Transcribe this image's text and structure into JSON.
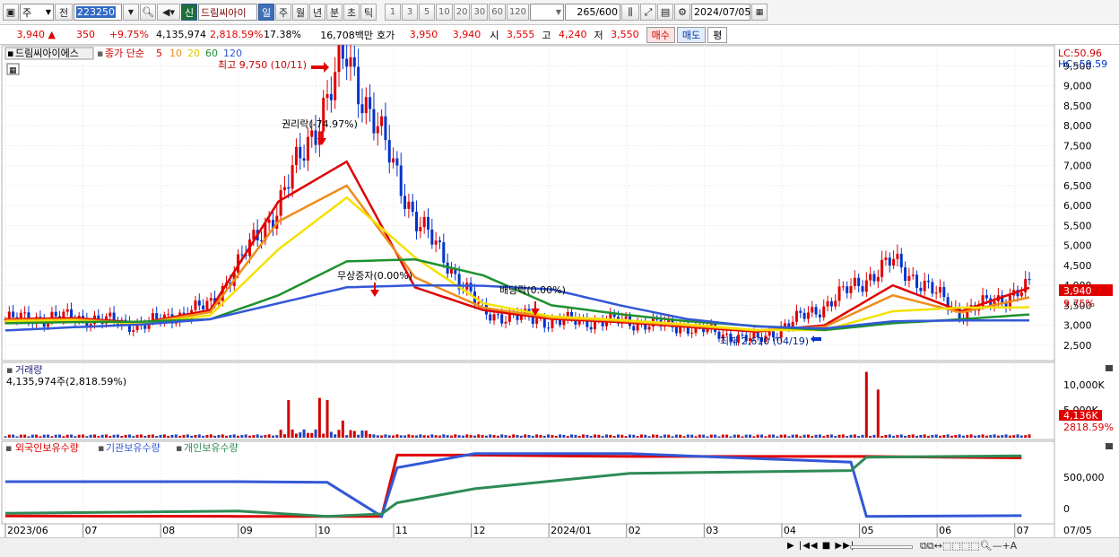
{
  "toolbar": {
    "market_type": "주",
    "prev_label": "전",
    "code": "223250",
    "stock_name_badge": "신",
    "stock_name": "드림씨아이",
    "periods": [
      "일",
      "주",
      "월",
      "년",
      "분",
      "초",
      "틱"
    ],
    "active_period": "일",
    "minute_units": [
      "1",
      "3",
      "5",
      "10",
      "20",
      "30",
      "60",
      "120"
    ],
    "count_value": "265",
    "count_total": "/600",
    "date": "2024/07/05"
  },
  "quote": {
    "price": "3,940",
    "arrow": "▲",
    "change": "350",
    "change_pct": "+9.75%",
    "volume": "4,135,974",
    "volume_ratio": "2,818.59%",
    "turnover": "17.38%",
    "trade_amount": "16,708백만",
    "hoga_label": "호가",
    "ask": "3,950",
    "bid": "3,940",
    "open_label": "시",
    "open": "3,555",
    "high_label": "고",
    "high": "4,240",
    "low_label": "저",
    "low": "3,550",
    "buy_label": "매수",
    "sell_label": "매도",
    "avg_label": "평"
  },
  "price_panel": {
    "stock_chip": "드림씨아이에스",
    "ma_title": "종가 단순",
    "ma_periods": [
      "5",
      "10",
      "20",
      "60",
      "120"
    ],
    "ma_colors": [
      "#e00000",
      "#f08c1a",
      "#f5e100",
      "#1e9130",
      "#3358d6"
    ],
    "lc": "LC:50.96",
    "hc": "HC:-59.59",
    "last_price_tag": "3,940",
    "last_pct_tag": "9.75%",
    "ann_high": "최고 9,750 (10/11)",
    "ann_rights": "권리락(-74.97%)",
    "ann_bonus": "무상증자(0.00%)",
    "ann_dividend": "배당락(0.00%)",
    "ann_low": "최저 2,610 (04/19)"
  },
  "volume_panel": {
    "title": "거래량",
    "summary": "4,135,974주(2,818.59%)",
    "ticks": [
      "10,000K",
      "5,000K"
    ],
    "last_tag": "4,136K",
    "last_pct": "2818.59%"
  },
  "holding_panel": {
    "legend": [
      "외국인보유수량",
      "기관보유수량",
      "개인보유수량"
    ],
    "legend_colors": [
      "#e00000",
      "#3358d6",
      "#2e8b57"
    ],
    "ticks": [
      "500,000",
      "0"
    ]
  },
  "x_axis": {
    "labels": [
      "2023/06",
      "07",
      "08",
      "09",
      "10",
      "11",
      "12",
      "2024/01",
      "02",
      "03",
      "04",
      "05",
      "06",
      "07"
    ],
    "right_label": "07/05"
  },
  "chart_data": [
    {
      "type": "candlestick",
      "title": "드림씨아이에스",
      "period": "daily",
      "x_range": [
        "2023/06/01",
        "2024/07/05"
      ],
      "y_ticks": [
        2500,
        3000,
        3500,
        4000,
        4500,
        5000,
        5500,
        6000,
        6500,
        7000,
        7500,
        8000,
        8500,
        9000,
        9500
      ],
      "ylim": [
        2250,
        9800
      ],
      "series": [
        {
          "name": "5",
          "values": [
            3150,
            3180,
            3060,
            3380,
            6100,
            7100,
            3950,
            3380,
            3160,
            3080,
            2960,
            2840,
            3000,
            4000,
            3350,
            3940
          ]
        },
        {
          "name": "10",
          "values": [
            3130,
            3150,
            3050,
            3330,
            5600,
            6500,
            4200,
            3440,
            3190,
            3110,
            2990,
            2870,
            2960,
            3750,
            3320,
            3700
          ]
        },
        {
          "name": "20",
          "values": [
            3100,
            3120,
            3040,
            3250,
            4900,
            6200,
            4700,
            3550,
            3220,
            3130,
            3020,
            2880,
            2880,
            3350,
            3440,
            3450
          ]
        },
        {
          "name": "60",
          "values": [
            3050,
            3080,
            3090,
            3150,
            3750,
            4600,
            4650,
            4250,
            3500,
            3280,
            3100,
            2980,
            2880,
            3050,
            3150,
            3270
          ]
        },
        {
          "name": "120",
          "values": [
            2870,
            2950,
            3020,
            3150,
            3550,
            3950,
            4000,
            3990,
            3900,
            3500,
            3150,
            2970,
            2920,
            3100,
            3120,
            3120
          ]
        }
      ],
      "close_key": {
        "dates": [
          "2023/06",
          "2023/07",
          "2023/08",
          "2023/09",
          "2023/09/20",
          "2023/10/11",
          "2023/10/20",
          "2023/11",
          "2023/12",
          "2024/01",
          "2024/02",
          "2024/04/19",
          "2024/05",
          "2024/05/10",
          "2024/06",
          "2024/07/05"
        ],
        "close": [
          3150,
          3200,
          3000,
          3500,
          6000,
          9750,
          5700,
          3300,
          3100,
          3100,
          2950,
          2610,
          3500,
          4600,
          3300,
          3940
        ]
      }
    },
    {
      "type": "bar",
      "title": "거래량",
      "unit": "K shares",
      "ylim": [
        0,
        12000
      ],
      "peaks": [
        {
          "date": "2023/09/20",
          "value": 6800
        },
        {
          "date": "2023/10/02",
          "value": 7200
        },
        {
          "date": "2023/10/05",
          "value": 6800
        },
        {
          "date": "2023/10/11",
          "value": 3100
        },
        {
          "date": "2024/05/02",
          "value": 11900
        },
        {
          "date": "2024/05/06",
          "value": 8700
        },
        {
          "date": "2024/07/05",
          "value": 4136
        }
      ]
    },
    {
      "type": "line",
      "title": "보유수량",
      "ylim": [
        -50000,
        1000000
      ],
      "x": [
        "2023/06",
        "2023/09",
        "2023/10/05",
        "2023/10/25",
        "2023/11",
        "2023/12",
        "2024/02",
        "2024/04/25",
        "2024/05",
        "2024/07"
      ],
      "series": [
        {
          "name": "외국인보유수량",
          "values": [
            10000,
            5000,
            5000,
            5000,
            880000,
            880000,
            860000,
            860000,
            860000,
            840000
          ]
        },
        {
          "name": "기관보유수량",
          "values": [
            500000,
            500000,
            490000,
            5000,
            700000,
            900000,
            900000,
            780000,
            5000,
            15000
          ]
        },
        {
          "name": "개인보유수량",
          "values": [
            50000,
            80000,
            5000,
            40000,
            200000,
            400000,
            620000,
            660000,
            850000,
            870000
          ]
        }
      ]
    }
  ]
}
